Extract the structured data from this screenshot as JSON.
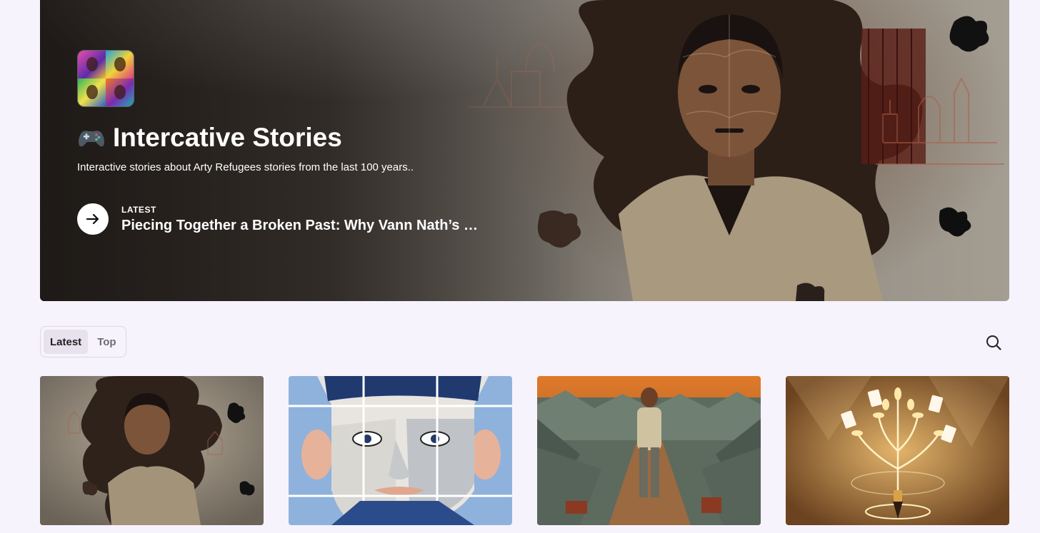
{
  "hero": {
    "title": "Intercative Stories",
    "subtitle": "Interactive stories about Arty Refugees stories from the last 100 years..",
    "latest_label": "LATEST",
    "latest_title": "Piecing Together a Broken Past: Why Vann Nath’s Radical…"
  },
  "tabs": [
    {
      "label": "Latest",
      "active": true
    },
    {
      "label": "Top",
      "active": false
    }
  ],
  "icons": {
    "title_icon": "gamepad-icon",
    "latest_button_icon": "arrow-right-icon",
    "search_icon": "search-icon"
  },
  "posts": [
    {
      "thumbnail": "jigsaw-portrait-thumbnail"
    },
    {
      "thumbnail": "grid-face-illustration-thumbnail"
    },
    {
      "thumbnail": "refugee-camp-walker-thumbnail"
    },
    {
      "thumbnail": "golden-tree-pen-thumbnail"
    }
  ],
  "colors": {
    "page_background": "#f7f3fd",
    "tab_active_background": "#e8e2ef",
    "hero_text": "#ffffff"
  }
}
